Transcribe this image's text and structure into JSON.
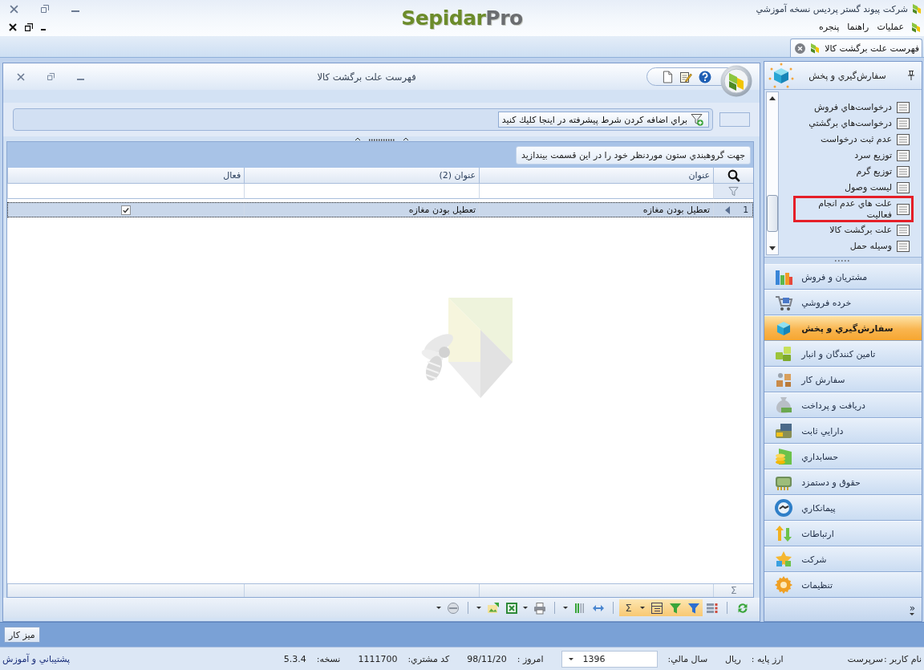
{
  "app": {
    "title": "شركت پيوند گستر پرديس نسخه آموزشي",
    "logo": {
      "primary": "Sepidar",
      "secondary": "Pro"
    }
  },
  "menu": [
    "عمليات",
    "راهنما",
    "پنجره"
  ],
  "doc_tabs": [
    {
      "label": "فهرست علت برگشت كالا",
      "selected": true
    }
  ],
  "child_window": {
    "title": "فهرست علت برگشت كالا",
    "filter_button": "براي اضافه كردن شرط پيشرفته در اينجا كليك كنيد",
    "group_panel_hint": "جهت گروهبندي ستون موردنظر خود را در اين قسمت بيندازيد",
    "table": {
      "columns": [
        "عنوان",
        "عنوان (2)",
        "فعال"
      ],
      "rows": [
        {
          "number": "1",
          "cells": [
            "تعطيل بودن مغازه",
            "تعطيل بودن مغازه"
          ],
          "checked": true,
          "selected": true
        }
      ],
      "footer_symbol": "Σ"
    },
    "toolbar": [
      {
        "kind": "button",
        "pressed": false
      },
      {
        "kind": "separator"
      },
      {
        "kind": "button",
        "pressed": false
      },
      {
        "kind": "button",
        "pressed": true
      },
      {
        "kind": "button",
        "pressed": true
      },
      {
        "kind": "button",
        "pressed": true
      },
      {
        "kind": "dropdown",
        "pressed": true
      },
      {
        "kind": "button",
        "label": "Σ",
        "pressed": true
      },
      {
        "kind": "separator"
      },
      {
        "kind": "button",
        "pressed": false
      },
      {
        "kind": "button",
        "pressed": false
      },
      {
        "kind": "dropdown",
        "pressed": false
      },
      {
        "kind": "separator"
      },
      {
        "kind": "button",
        "pressed": false
      },
      {
        "kind": "dropdown",
        "pressed": false
      },
      {
        "kind": "button",
        "pressed": false
      },
      {
        "kind": "button",
        "pressed": false
      },
      {
        "kind": "dropdown",
        "pressed": false
      },
      {
        "kind": "separator"
      },
      {
        "kind": "button",
        "pressed": false
      },
      {
        "kind": "dropdown",
        "pressed": false
      }
    ]
  },
  "nav": {
    "header": "سفارش‌گيري و پخش",
    "items": [
      {
        "label": "درخواست‌هاي فروش",
        "highlighted": false
      },
      {
        "label": "درخواست‌هاي برگشتي",
        "highlighted": false
      },
      {
        "label": "عدم ثبت درخواست",
        "highlighted": false
      },
      {
        "label": "توزيع سرد",
        "highlighted": false
      },
      {
        "label": "توزيع گرم",
        "highlighted": false
      },
      {
        "label": "ليست وصول",
        "highlighted": false
      },
      {
        "label": "علت هاي عدم انجام فعاليت",
        "highlighted": true
      },
      {
        "label": "علت برگشت كالا",
        "highlighted": false
      },
      {
        "label": "وسيله حمل",
        "highlighted": false
      }
    ],
    "modules": [
      {
        "label": "مشتريان و فروش",
        "selected": false
      },
      {
        "label": "خرده فروشي",
        "selected": false
      },
      {
        "label": "سفارش‌گيري و پخش",
        "selected": true
      },
      {
        "label": "تامين كنندگان و انبار",
        "selected": false
      },
      {
        "label": "سفارش كار",
        "selected": false
      },
      {
        "label": "دريافت و پرداخت",
        "selected": false
      },
      {
        "label": "دارايي ثابت",
        "selected": false
      },
      {
        "label": "حسابداري",
        "selected": false
      },
      {
        "label": "حقوق و دستمزد",
        "selected": false
      },
      {
        "label": "پيمانكاري",
        "selected": false
      },
      {
        "label": "ارتباطات",
        "selected": false
      },
      {
        "label": "شركت",
        "selected": false
      },
      {
        "label": "تنظيمات",
        "selected": false
      }
    ],
    "more": "»"
  },
  "taskbar": {
    "button": "ميز كار"
  },
  "status_bar": {
    "fields": [
      {
        "kind": "text",
        "label": "نام كاربر :",
        "value": "سرپرست"
      },
      {
        "kind": "text",
        "label": "ارز پايه :",
        "value": "ريال"
      },
      {
        "kind": "dropdown",
        "label": "سال مالي:",
        "value": "1396"
      },
      {
        "kind": "text",
        "label": "امروز :",
        "value": "98/11/20"
      },
      {
        "kind": "text",
        "label": "كد مشتري:",
        "value": "1111700"
      },
      {
        "kind": "text",
        "label": "نسخه:",
        "value": "5.3.4"
      }
    ],
    "link": "پشتيباني و آموزش"
  }
}
